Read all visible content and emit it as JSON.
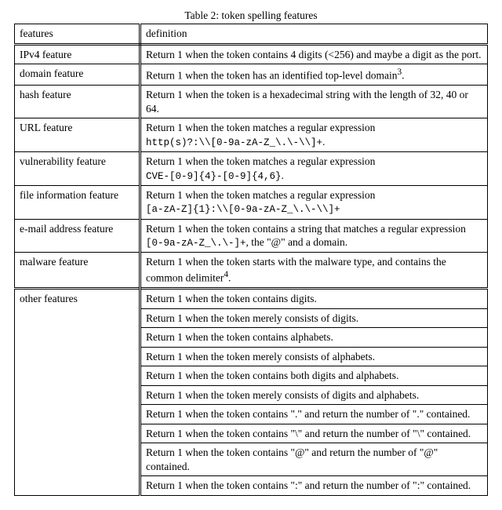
{
  "caption": "Table 2: token spelling features",
  "header": {
    "c1": "features",
    "c2": "definition"
  },
  "rows": [
    {
      "feature": "IPv4 feature",
      "def": "Return 1 when the token contains 4 digits (<256) and maybe a digit as the port."
    },
    {
      "feature": "domain feature",
      "def": "Return 1 when the token has an identified top-level domain",
      "sup": "3",
      "def_tail": "."
    },
    {
      "feature": "hash feature",
      "def": "Return 1 when the token is a hexadecimal string with the length of 32, 40 or 64."
    },
    {
      "feature": "URL feature",
      "def_pre": "Return 1 when the token matches a regular expression ",
      "code": "http(s)?:\\\\[0-9a-zA-Z_\\.\\-\\\\]+",
      "def_post": "."
    },
    {
      "feature": "vulnerability feature",
      "def_pre": "Return 1 when the token matches a regular expression ",
      "code": "CVE-[0-9]{4}-[0-9]{4,6}",
      "def_post": "."
    },
    {
      "feature": "file information feature",
      "def_pre": "Return 1 when the token matches a regular expression ",
      "code": "[a-zA-Z]{1}:\\\\[0-9a-zA-Z_\\.\\-\\\\]+"
    },
    {
      "feature": "e-mail address feature",
      "def_pre": "Return 1 when the token contains a string that matches a regular expression ",
      "code": "[0-9a-zA-Z_\\.\\-]+",
      "def_post": ", the \"@\" and a domain."
    },
    {
      "feature": "malware feature",
      "def": "Return 1 when the token starts with the malware type, and contains the common delimiter",
      "sup": "4",
      "def_tail": "."
    }
  ],
  "other_label": "other features",
  "other_defs": [
    "Return 1 when the token contains digits.",
    "Return 1 when the token merely consists of digits.",
    "Return 1 when the token contains alphabets.",
    "Return 1 when the token merely consists of alphabets.",
    "Return 1 when the token contains both digits and alphabets.",
    "Return 1 when the token merely consists of digits and alphabets.",
    "Return 1 when the token contains \".\" and return the number of \".\" contained.",
    "Return 1 when the token contains \"\\\" and return the number of \"\\\" contained.",
    "Return 1 when the token contains \"@\" and return the number of \"@\" contained.",
    "Return 1 when the token contains \":\" and return the number of \":\" contained."
  ]
}
